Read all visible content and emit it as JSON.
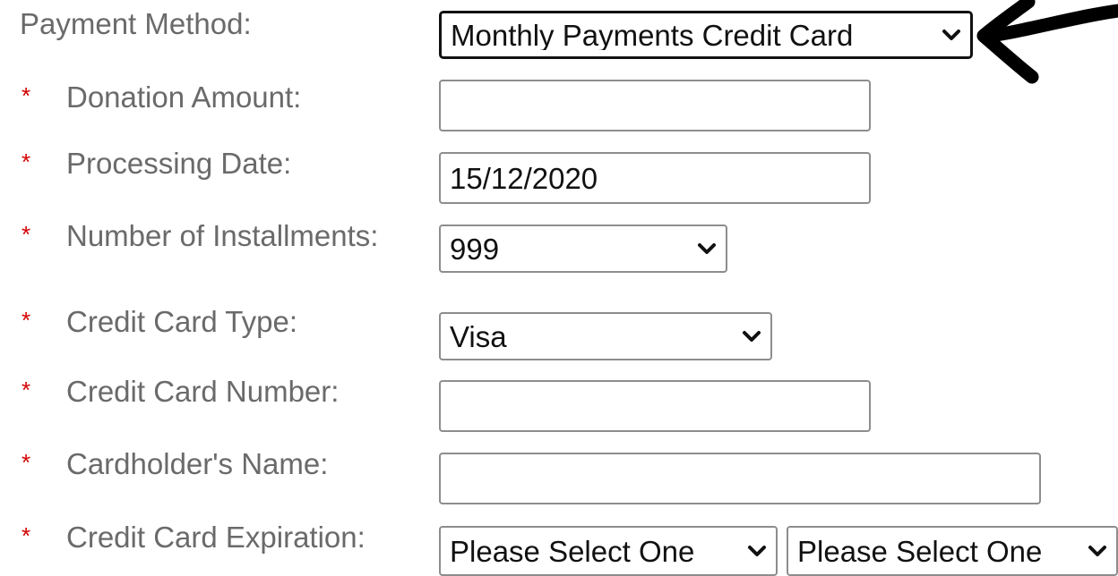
{
  "form": {
    "payment_method": {
      "label": "Payment Method:",
      "selected": "Monthly Payments Credit Card"
    },
    "donation_amount": {
      "required_mark": "*",
      "label": "Donation Amount:",
      "value": ""
    },
    "processing_date": {
      "required_mark": "*",
      "label": "Processing Date:",
      "value": "15/12/2020"
    },
    "installments": {
      "required_mark": "*",
      "label": "Number of Installments:",
      "selected": "999"
    },
    "card_type": {
      "required_mark": "*",
      "label": "Credit Card Type:",
      "selected": "Visa"
    },
    "card_number": {
      "required_mark": "*",
      "label": "Credit Card Number:",
      "value": ""
    },
    "cardholder_name": {
      "required_mark": "*",
      "label": "Cardholder's Name:",
      "value": ""
    },
    "expiration": {
      "required_mark": "*",
      "label": "Credit Card Expiration:",
      "month_selected": "Please Select One",
      "year_selected": "Please Select One"
    }
  },
  "annotation": {
    "icon": "hand-drawn-arrow-icon",
    "color": "#000000"
  },
  "colors": {
    "required": "#d40000",
    "label": "#6a6a6a"
  }
}
